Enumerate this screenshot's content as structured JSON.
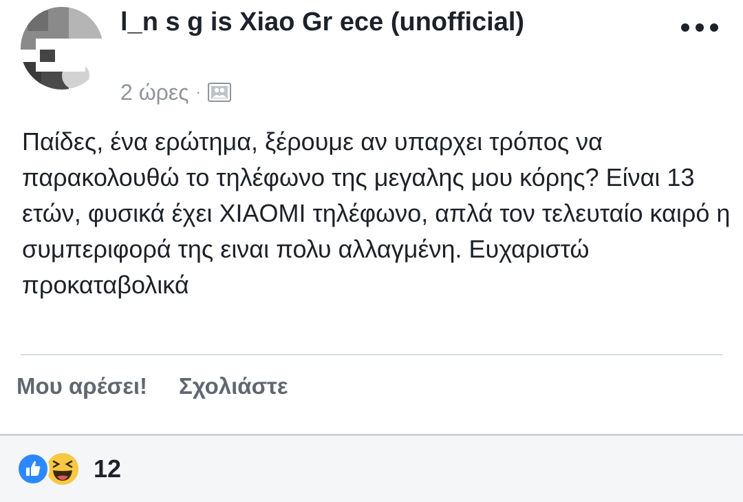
{
  "post": {
    "group_name": "l_n    s   g   is   Xiao   Gr ece (unofficial)",
    "timestamp": "2 ώρες",
    "separator": "·",
    "audience_icon": "group-audience-icon",
    "more_icon": "more-options-icon",
    "message": "Παίδες, ένα ερώτημα, ξέρουμε αν υπαρχει τρόπος να παρακολουθώ το τηλέφωνο της μεγαλης μου κόρης? Είναι 13 ετών, φυσικά έχει XIAOMI τηλέφωνο, απλά τον τελευταίο καιρό η συμπεριφορά της ειναι πολυ αλλαγμένη. Ευχαριστώ προκαταβολικά"
  },
  "actions": {
    "like_label": "Μου αρέσει!",
    "comment_label": "Σχολιάστε"
  },
  "reactions": {
    "types": [
      "like",
      "haha"
    ],
    "count": "12"
  },
  "colors": {
    "text": "#1d2129",
    "secondary": "#90949c",
    "action": "#606770",
    "like_blue": "#2d88ff",
    "haha_yellow": "#f7c844"
  }
}
